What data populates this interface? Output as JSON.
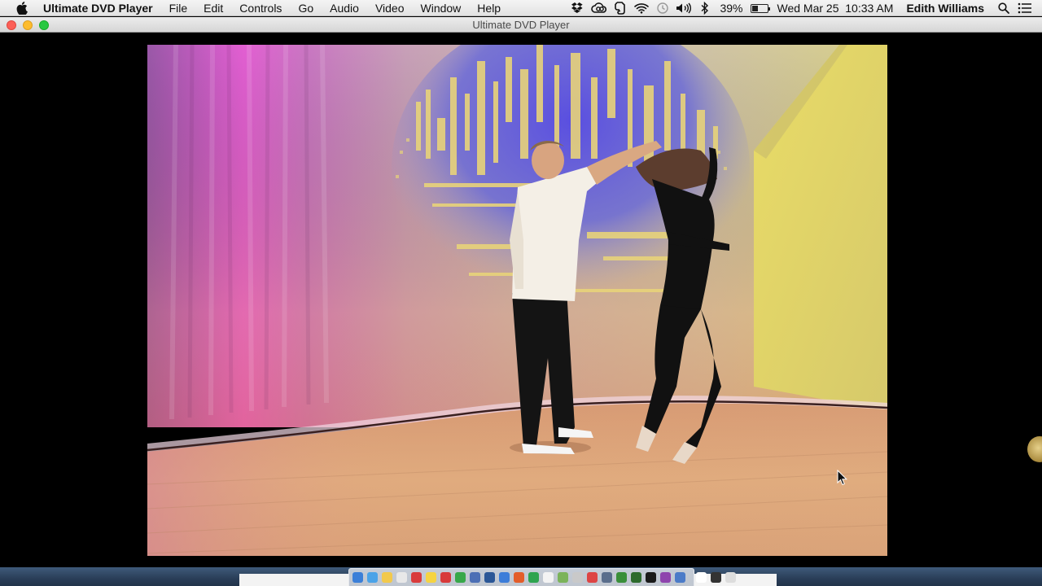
{
  "menubar": {
    "app_name": "Ultimate DVD Player",
    "menus": [
      "File",
      "Edit",
      "Controls",
      "Go",
      "Audio",
      "Video",
      "Window",
      "Help"
    ],
    "battery_percent": "39%",
    "battery_level": 0.39,
    "datetime": "Wed Mar 25  10:33 AM",
    "user_name": "Edith Williams",
    "tray_icons": [
      "dropbox-icon",
      "creative-cloud-icon",
      "evernote-icon",
      "wifi-icon",
      "time-machine-icon",
      "volume-icon",
      "bluetooth-icon",
      "battery-icon",
      "spotlight-icon",
      "notification-center-icon"
    ]
  },
  "window": {
    "title": "Ultimate DVD Player"
  },
  "dock": {
    "icon_count": 26,
    "icon_colors": [
      "#3b7fd8",
      "#4aa3e8",
      "#f2c94c",
      "#e8e8e8",
      "#d93b3b",
      "#f5d442",
      "#d83a3a",
      "#37a84a",
      "#4c6fb5",
      "#2b5797",
      "#3c7dd9",
      "#e35d2a",
      "#2ea44f",
      "#f3f3f3",
      "#7bb35a",
      "#c9c9c9",
      "#d44",
      "#5a6e8c",
      "#3a8f3a",
      "#2d6b2d",
      "#1a1a1a",
      "#8e44ad",
      "#4b7bc8",
      "#ffffff",
      "#333333",
      "#dddddd"
    ]
  },
  "colors": {
    "menubar_bg": "#ececec",
    "video_bg": "#000000",
    "desktop": "#2f4663"
  }
}
